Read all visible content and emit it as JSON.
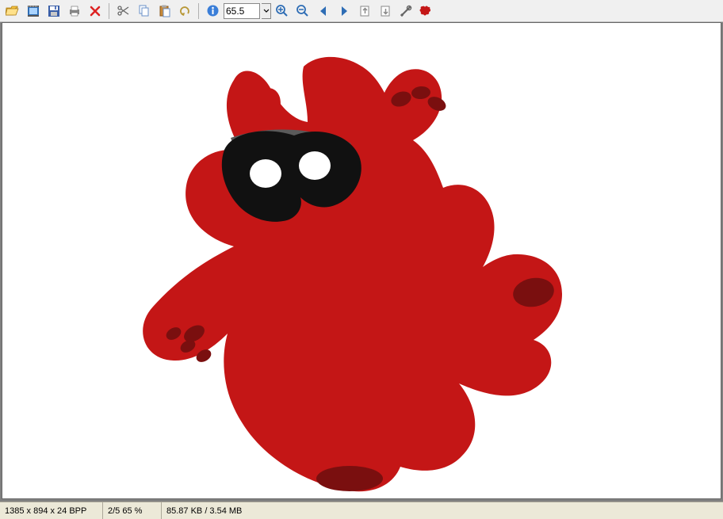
{
  "zoom": {
    "value": "65.5"
  },
  "status": {
    "dimensions": "1385 x 894 x 24 BPP",
    "index_zoom": "2/5  65 %",
    "sizes": "85.87 KB / 3.54 MB"
  },
  "colors": {
    "mascot_body": "#c41616",
    "mascot_dark": "#7a0f0f",
    "mask": "#111111",
    "mask_band": "#555555",
    "eye": "#ffffff"
  }
}
